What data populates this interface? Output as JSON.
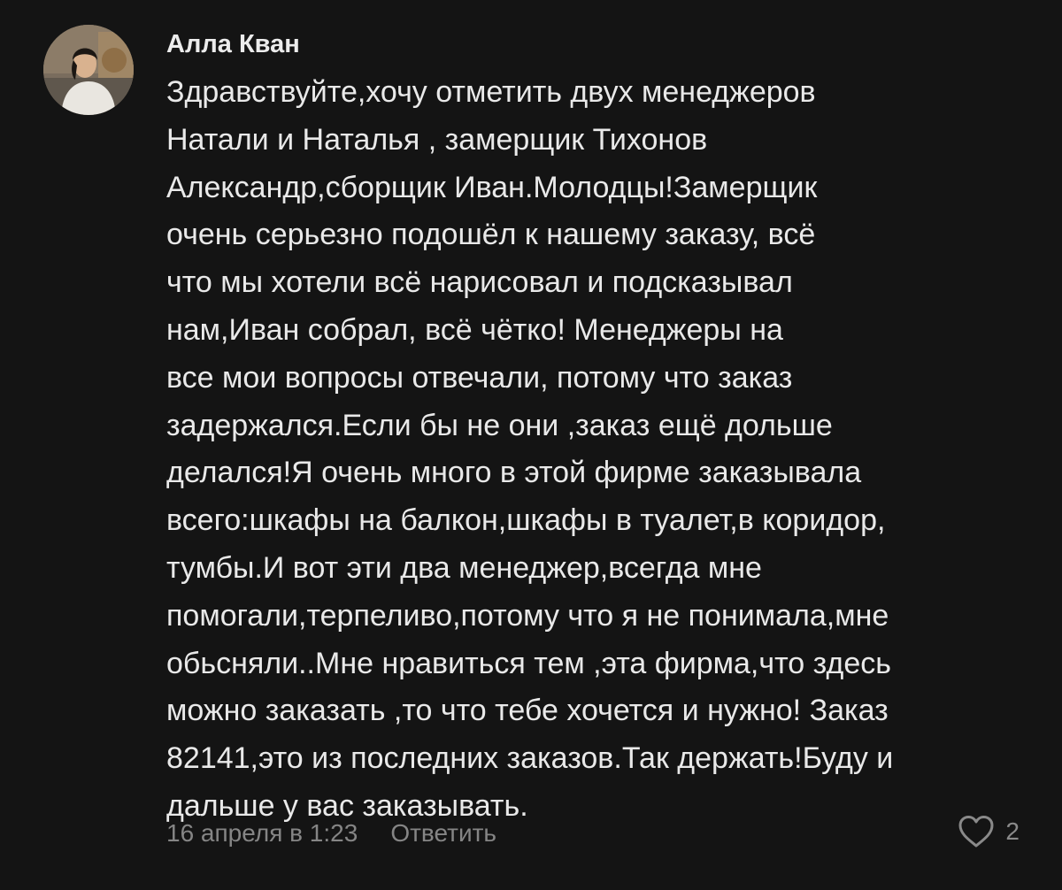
{
  "comment": {
    "author": "Алла Кван",
    "lines": [
      "Здравствуйте,хочу отметить двух менеджеров",
      "Натали и Наталья , замерщик Тихонов",
      "Александр,сборщик Иван.Молодцы!Замерщик",
      "очень серьезно подошёл к нашему заказу, всё",
      "что мы хотели всё нарисовал и подсказывал",
      "нам,Иван собрал, всё чётко! Менеджеры на",
      "все мои вопросы отвечали, потому что заказ",
      "задержался.Если бы не они ,заказ ещё дольше",
      "делался!Я очень много в этой фирме заказывала",
      "всего:шкафы на балкон,шкафы в туалет,в коридор,",
      "тумбы.И вот эти два менеджер,всегда мне",
      "помогали,терпеливо,потому что я не понимала,мне",
      "обьсняли..Мне нравиться тем ,эта фирма,что здесь",
      "можно заказать ,то что тебе хочется и нужно! Заказ",
      "82141,это из последних заказов.Так держать!Буду и",
      "дальше у вас заказывать."
    ],
    "date": "16 апреля в 1:23",
    "reply_label": "Ответить",
    "likes": "2",
    "icons": {
      "avatar": "user-avatar-photo",
      "like": "heart-outline-icon"
    }
  },
  "colors": {
    "background": "#141414",
    "text": "#e9e9e9",
    "meta": "#858585"
  }
}
